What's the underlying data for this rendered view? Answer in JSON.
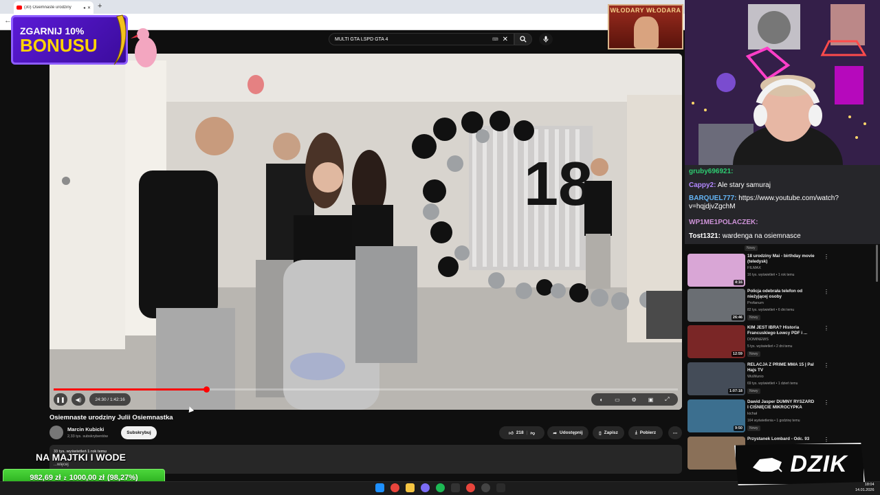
{
  "browser": {
    "tab_title": "(30) Osiemnaste urodziny",
    "new_tab": "+",
    "back": "←"
  },
  "youtube": {
    "search_query": "MULTI GTA LSPD GTA 4",
    "clear": "✕",
    "player": {
      "current_time": "24:30 / 1:42:16",
      "progress": 0.245
    },
    "video": {
      "title": "Osiemnaste urodziny Julii Osiemnastka",
      "channel": "Marcin Kubicki",
      "subscribers": "2,33 tys. subskrybentów",
      "subscribe_label": "Subskrybuj",
      "likes": "218",
      "share_label": "Udostępnij",
      "save_label": "Zapisz",
      "download_label": "Pobierz",
      "views": "33 tys. wyświetleń  1 rok temu",
      "more_label": "...więcej"
    }
  },
  "overlays": {
    "bonus_line1": "ZGARNIJ 10%",
    "bonus_line2": "BONUSU",
    "poster_text": "WŁODARY WŁODARA",
    "majtki": "NA MAJTKI I WODE",
    "goal_current": "982,69 zł",
    "goal_sep": "z",
    "goal_target": "1000,00 zł",
    "goal_percent": "(98,27%)",
    "sponsor": "DZIK"
  },
  "chat": [
    {
      "user": "gruby696921:",
      "msg": "",
      "color": "#2ecc71"
    },
    {
      "user": "Cappy2:",
      "msg": "Ale stary samuraj",
      "color": "#b388ff"
    },
    {
      "user": "BARQUEL777:",
      "msg": "https://www.youtube.com/watch?v=hqjdjvZgchM",
      "color": "#64b5f6"
    },
    {
      "user": "WP1ME1POLACZEK:",
      "msg": "",
      "color": "#ce93d8"
    },
    {
      "user": "Tost1321:",
      "msg": "wardenga na osiemnasce",
      "color": "#ffffff"
    }
  ],
  "recommendations": [
    {
      "title": "18 urodziny Mai - birthday movie (teledysk)",
      "channel": "FILMAX",
      "meta": "16 tys. wyświetleń • 1 rok temu",
      "duration": "4:16",
      "badge": ""
    },
    {
      "title": "Policja odebrała telefon od nieżyjącej osoby",
      "channel": "Profanum",
      "meta": "82 tys. wyświetleń • 6 dni temu",
      "duration": "26:46",
      "badge": "Nowy"
    },
    {
      "title": "KIM JEST IBRA? Historia Francuskiego Łowcy PDF i ...",
      "channel": "DOMINEWS",
      "meta": "5 tys. wyświetleń • 2 dni temu",
      "duration": "12:59",
      "badge": "Nowy"
    },
    {
      "title": "RELACJA Z PRIME MMA 15 | Pal Hajs TV",
      "channel": "WuWunio",
      "meta": "69 tys. wyświetleń • 1 dzień temu",
      "duration": "1:07:18",
      "badge": "Nowy"
    },
    {
      "title": "Dawid Jasper DUMNY RYSZARD I CIŚNIĘCIE MIKROCYPKA",
      "channel": "kichał",
      "meta": "164 wyświetlenia • 1 godzinę temu",
      "duration": "9:50",
      "badge": "Nowy"
    },
    {
      "title": "Przystanek Lombard - Odc. 93",
      "channel": "",
      "meta": "",
      "duration": "",
      "badge": ""
    }
  ],
  "rec_above_badge": "Nowy",
  "clock": {
    "time": "18:04",
    "date": "14.01.2026"
  },
  "colors": {
    "accent": "#ff0000",
    "bonus": "#5b1ad6",
    "goal": "#3cc22c"
  }
}
